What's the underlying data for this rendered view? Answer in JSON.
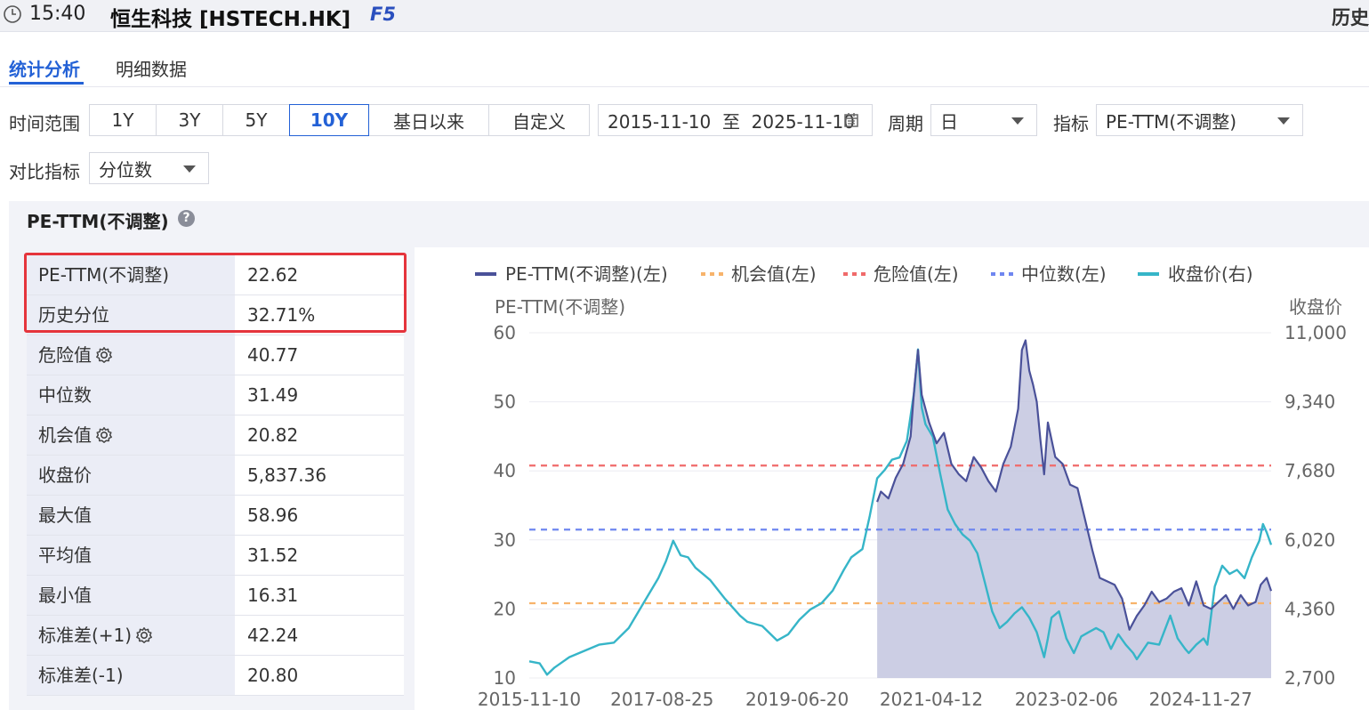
{
  "header": {
    "time": "15:40",
    "instrument": "恒生科技 [HSTECH.HK]",
    "hotkey": "F5",
    "right_label": "历史"
  },
  "tabs": [
    {
      "label": "统计分析",
      "active": true
    },
    {
      "label": "明细数据",
      "active": false
    }
  ],
  "controls": {
    "range_label": "时间范围",
    "range_options": [
      "1Y",
      "3Y",
      "5Y",
      "10Y",
      "基日以来",
      "自定义"
    ],
    "range_selected": "10Y",
    "date_range": "2015-11-10  至  2025-11-10",
    "period_label": "周期",
    "period_value": "日",
    "indicator_label": "指标",
    "indicator_value": "PE-TTM(不调整)",
    "compare_label": "对比指标",
    "compare_value": "分位数"
  },
  "panel": {
    "title": "PE-TTM(不调整)",
    "help_glyph": "?"
  },
  "stats": [
    {
      "key": "PE-TTM(不调整)",
      "value": "22.62",
      "gear": false
    },
    {
      "key": "历史分位",
      "value": "32.71%",
      "gear": false
    },
    {
      "key": "危险值",
      "value": "40.77",
      "gear": true
    },
    {
      "key": "中位数",
      "value": "31.49",
      "gear": false
    },
    {
      "key": "机会值",
      "value": "20.82",
      "gear": true
    },
    {
      "key": "收盘价",
      "value": "5,837.36",
      "gear": false
    },
    {
      "key": "最大值",
      "value": "58.96",
      "gear": false
    },
    {
      "key": "平均值",
      "value": "31.52",
      "gear": false
    },
    {
      "key": "最小值",
      "value": "16.31",
      "gear": false
    },
    {
      "key": "标准差(+1)",
      "value": "42.24",
      "gear": true
    },
    {
      "key": "标准差(-1)",
      "value": "20.80",
      "gear": false
    }
  ],
  "chart_data": {
    "type": "line",
    "left_axis_title": "PE-TTM(不调整)",
    "right_axis_title": "收盘价",
    "left_ticks": [
      10,
      20,
      30,
      40,
      50,
      60
    ],
    "left_tick_labels": [
      "10",
      "20",
      "30",
      "40",
      "50",
      "60"
    ],
    "right_tick_labels": [
      "2,700",
      "4,360",
      "6,020",
      "7,680",
      "9,340",
      "11,000"
    ],
    "ylim_left": [
      10,
      60
    ],
    "ylim_right": [
      2700,
      11000
    ],
    "x_tick_labels": [
      "2015-11-10",
      "2017-08-25",
      "2019-06-20",
      "2021-04-12",
      "2023-02-06",
      "2024-11-27"
    ],
    "x_ticks_decimal_year": [
      2015.86,
      2017.65,
      2019.47,
      2021.28,
      2023.1,
      2024.91
    ],
    "xlim_decimal_year": [
      2015.86,
      2025.86
    ],
    "legend": [
      {
        "name": "PE-TTM(不调整)(左)",
        "color": "#4a5199",
        "style": "solid"
      },
      {
        "name": "机会值(左)",
        "color": "#f7b36b",
        "style": "dashed"
      },
      {
        "name": "危险值(左)",
        "color": "#f06a6a",
        "style": "dashed"
      },
      {
        "name": "中位数(左)",
        "color": "#6f86f0",
        "style": "dashed"
      },
      {
        "name": "收盘价(右)",
        "color": "#36b5c8",
        "style": "solid"
      }
    ],
    "reference_lines": {
      "opportunity": 20.82,
      "danger": 40.77,
      "median": 31.49
    },
    "series": [
      {
        "name": "PE-TTM(不调整)(左)",
        "axis": "left",
        "x": [
          2020.55,
          2020.6,
          2020.7,
          2020.8,
          2020.9,
          2021.0,
          2021.05,
          2021.1,
          2021.15,
          2021.25,
          2021.35,
          2021.45,
          2021.55,
          2021.65,
          2021.75,
          2021.85,
          2021.95,
          2022.05,
          2022.15,
          2022.25,
          2022.35,
          2022.45,
          2022.5,
          2022.55,
          2022.6,
          2022.65,
          2022.7,
          2022.75,
          2022.8,
          2022.85,
          2022.95,
          2023.05,
          2023.15,
          2023.25,
          2023.35,
          2023.45,
          2023.55,
          2023.65,
          2023.75,
          2023.85,
          2023.95,
          2024.05,
          2024.15,
          2024.25,
          2024.35,
          2024.45,
          2024.55,
          2024.65,
          2024.75,
          2024.85,
          2024.95,
          2025.05,
          2025.15,
          2025.25,
          2025.35,
          2025.45,
          2025.55,
          2025.65,
          2025.72,
          2025.8,
          2025.86
        ],
        "values": [
          35.5,
          37.0,
          36.0,
          39.0,
          41.0,
          45.0,
          52.0,
          57.5,
          51.0,
          47.0,
          44.0,
          45.5,
          41.0,
          39.5,
          38.5,
          42.0,
          40.5,
          38.5,
          37.0,
          41.0,
          43.5,
          49.0,
          57.5,
          58.9,
          54.5,
          52.5,
          50.0,
          44.5,
          39.5,
          47.0,
          42.0,
          41.0,
          38.0,
          37.5,
          33.0,
          28.5,
          24.5,
          24.0,
          23.5,
          21.5,
          17.0,
          19.0,
          20.5,
          22.5,
          21.0,
          21.5,
          22.5,
          23.0,
          20.5,
          24.0,
          20.5,
          20.0,
          21.0,
          22.0,
          20.0,
          22.0,
          20.5,
          21.0,
          23.5,
          24.5,
          22.6
        ]
      },
      {
        "name": "收盘价(右)",
        "axis": "right",
        "x": [
          2015.86,
          2016.0,
          2016.1,
          2016.2,
          2016.4,
          2016.6,
          2016.8,
          2017.0,
          2017.2,
          2017.4,
          2017.6,
          2017.7,
          2017.8,
          2017.9,
          2018.0,
          2018.1,
          2018.2,
          2018.3,
          2018.5,
          2018.7,
          2018.8,
          2019.0,
          2019.2,
          2019.35,
          2019.5,
          2019.65,
          2019.8,
          2019.95,
          2020.1,
          2020.2,
          2020.35,
          2020.45,
          2020.55,
          2020.65,
          2020.75,
          2020.85,
          2020.95,
          2021.05,
          2021.1,
          2021.15,
          2021.2,
          2021.3,
          2021.4,
          2021.5,
          2021.6,
          2021.7,
          2021.8,
          2021.9,
          2022.0,
          2022.1,
          2022.2,
          2022.3,
          2022.4,
          2022.5,
          2022.6,
          2022.7,
          2022.8,
          2022.85,
          2022.9,
          2023.0,
          2023.1,
          2023.2,
          2023.3,
          2023.4,
          2023.5,
          2023.6,
          2023.7,
          2023.8,
          2023.9,
          2024.0,
          2024.05,
          2024.2,
          2024.35,
          2024.5,
          2024.6,
          2024.7,
          2024.75,
          2024.85,
          2024.95,
          2025.0,
          2025.1,
          2025.2,
          2025.3,
          2025.4,
          2025.5,
          2025.6,
          2025.7,
          2025.75,
          2025.8,
          2025.86
        ],
        "values": [
          3100,
          3050,
          2780,
          2950,
          3200,
          3350,
          3500,
          3550,
          3900,
          4500,
          5100,
          5500,
          6000,
          5650,
          5600,
          5350,
          5200,
          5050,
          4600,
          4200,
          4050,
          3950,
          3600,
          3750,
          4100,
          4350,
          4500,
          4800,
          5300,
          5600,
          5800,
          6600,
          7500,
          7700,
          7950,
          8000,
          8400,
          9600,
          10600,
          9200,
          8800,
          8500,
          7600,
          6750,
          6400,
          6150,
          6000,
          5700,
          5000,
          4300,
          3900,
          4050,
          4250,
          4400,
          4150,
          3800,
          3200,
          3650,
          4150,
          4300,
          3650,
          3300,
          3700,
          3800,
          3900,
          3800,
          3400,
          3750,
          3500,
          3300,
          3150,
          3550,
          3500,
          4200,
          3650,
          3400,
          3300,
          3500,
          3650,
          3500,
          4900,
          5400,
          5200,
          5300,
          5100,
          5600,
          6000,
          6400,
          6200,
          5900
        ]
      }
    ]
  }
}
